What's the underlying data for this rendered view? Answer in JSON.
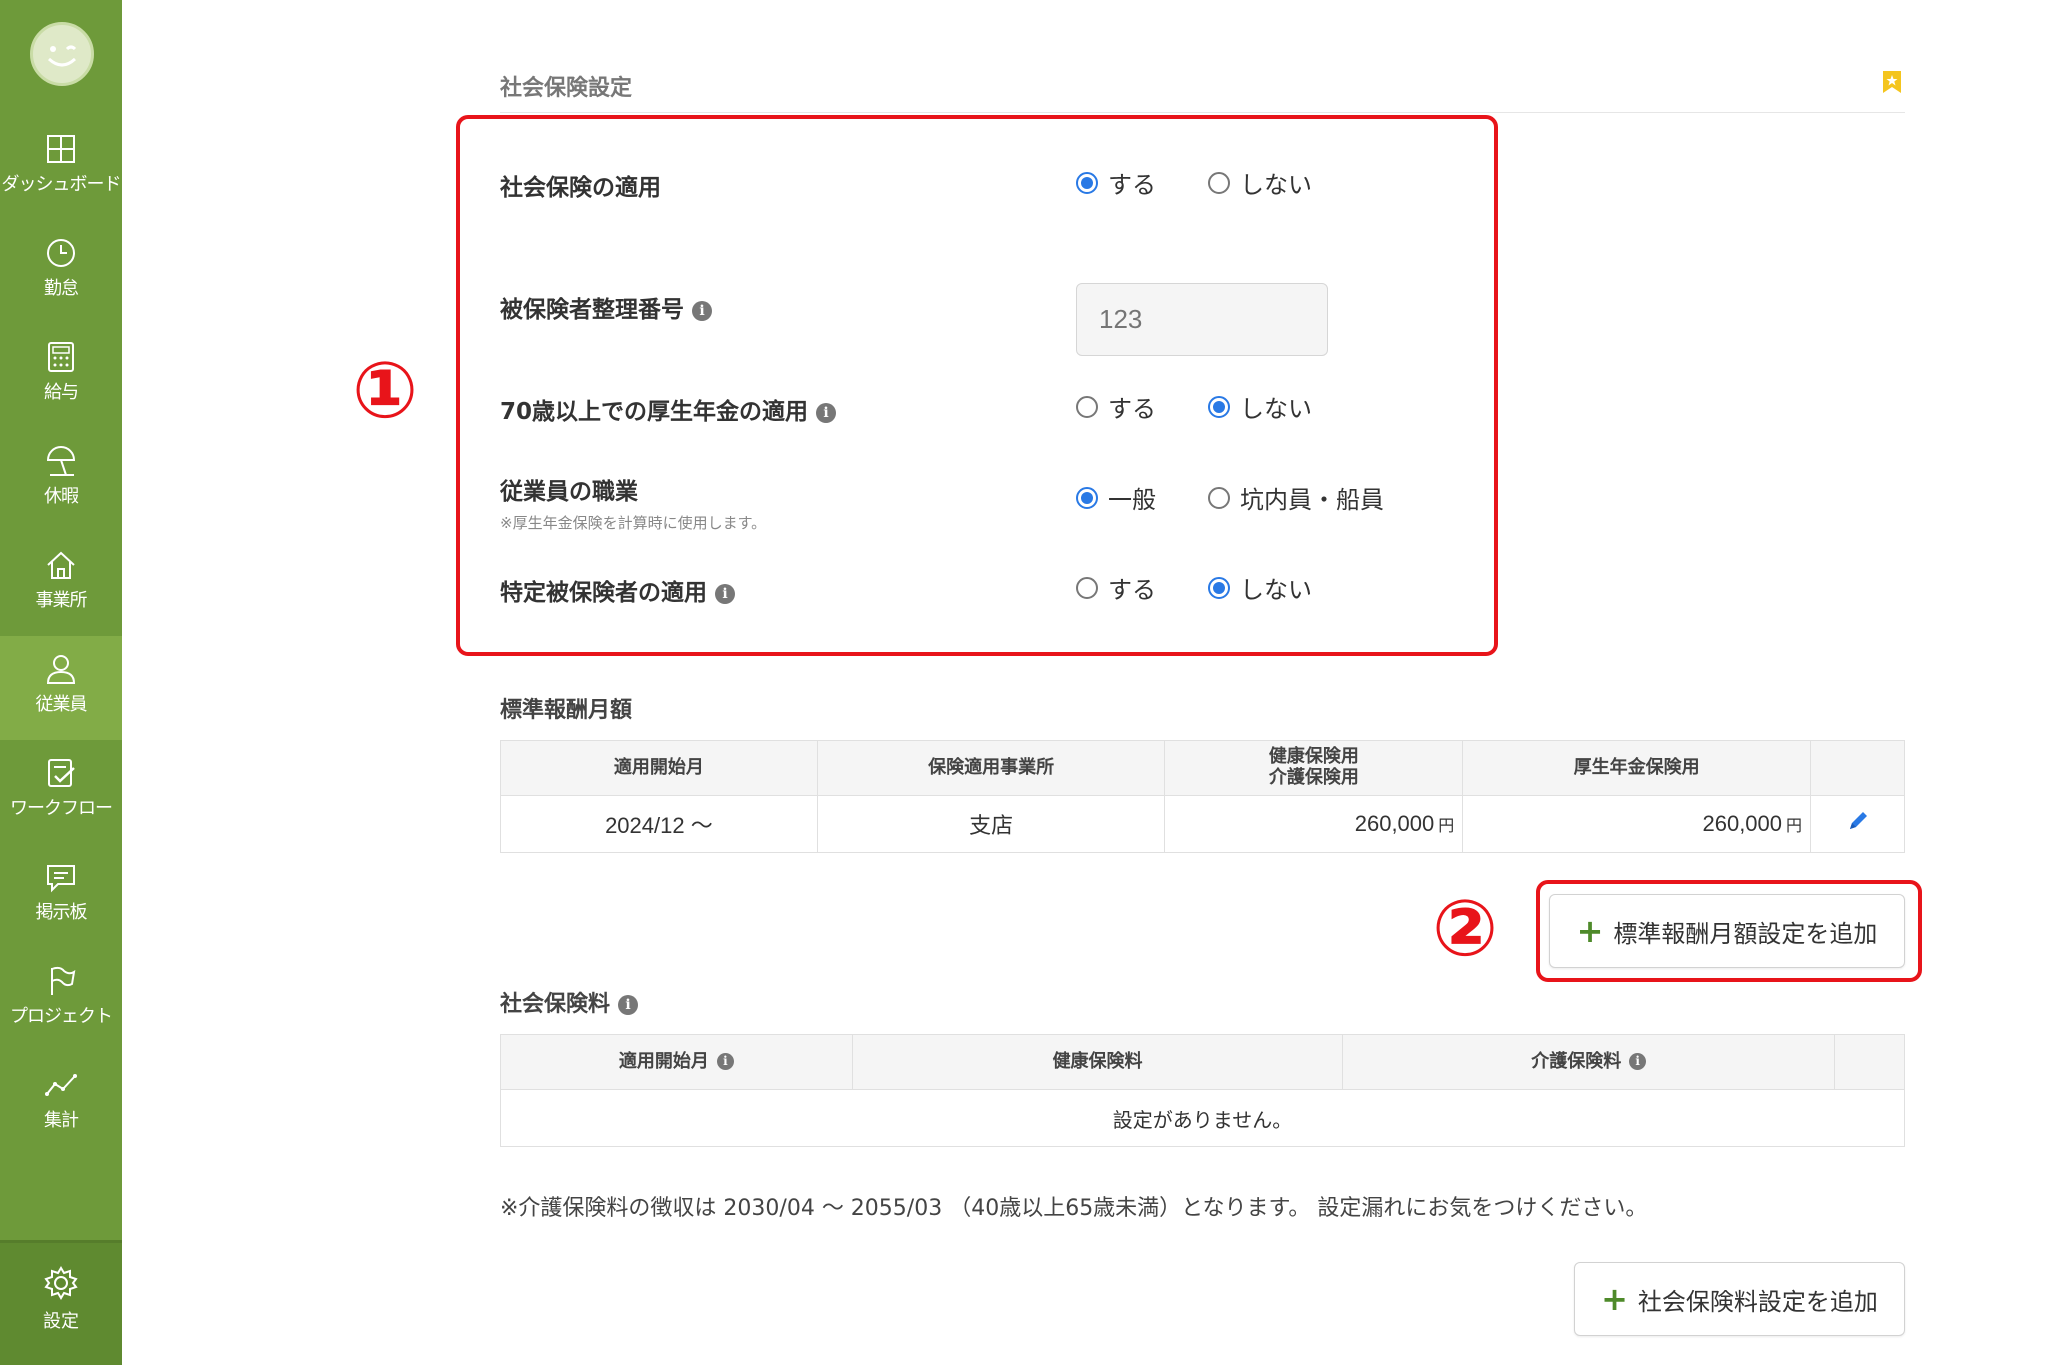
{
  "sidebar": {
    "items": [
      {
        "label": "ダッシュボード",
        "icon": "dashboard-icon"
      },
      {
        "label": "勤怠",
        "icon": "clock-icon"
      },
      {
        "label": "給与",
        "icon": "calculator-icon"
      },
      {
        "label": "休暇",
        "icon": "beach-umbrella-icon"
      },
      {
        "label": "事業所",
        "icon": "home-icon"
      },
      {
        "label": "従業員",
        "icon": "person-icon",
        "active": true
      },
      {
        "label": "ワークフロー",
        "icon": "checklist-icon"
      },
      {
        "label": "掲示板",
        "icon": "chat-icon"
      },
      {
        "label": "プロジェクト",
        "icon": "flag-icon"
      },
      {
        "label": "集計",
        "icon": "line-chart-icon"
      }
    ],
    "settings_label": "設定"
  },
  "section": {
    "title": "社会保険設定"
  },
  "annotations": {
    "one": "①",
    "two": "②"
  },
  "form": {
    "apply": {
      "label": "社会保険の適用",
      "opt_yes": "する",
      "opt_no": "しない",
      "selected": "yes"
    },
    "insured_number": {
      "label": "被保険者整理番号",
      "placeholder": "123"
    },
    "over70": {
      "label": "70歳以上での厚生年金の適用",
      "opt_yes": "する",
      "opt_no": "しない",
      "selected": "no"
    },
    "occupation": {
      "label": "従業員の職業",
      "note": "※厚生年金保険を計算時に使用します。",
      "opt_general": "一般",
      "opt_mine": "坑内員・船員",
      "selected": "general"
    },
    "specified": {
      "label": "特定被保険者の適用",
      "opt_yes": "する",
      "opt_no": "しない",
      "selected": "no"
    }
  },
  "standard_salary": {
    "title": "標準報酬月額",
    "headers": {
      "start": "適用開始月",
      "office": "保険適用事業所",
      "health_line1": "健康保険用",
      "health_line2": "介護保険用",
      "pension": "厚生年金保険用"
    },
    "rows": [
      {
        "start": "2024/12 〜",
        "office": "支店",
        "health": "260,000",
        "pension": "260,000",
        "unit": "円"
      }
    ],
    "add_button": "標準報酬月額設定を追加"
  },
  "premium": {
    "title": "社会保険料",
    "headers": {
      "start": "適用開始月",
      "health": "健康保険料",
      "care": "介護保険料"
    },
    "empty": "設定がありません。",
    "footnote": "※介護保険料の徴収は 2030/04 〜 2055/03 （40歳以上65歳未満）となります。 設定漏れにお気をつけください。",
    "add_button": "社会保険料設定を追加"
  },
  "colors": {
    "sidebar": "#6e9a3a",
    "accent_red": "#e8141a",
    "radio_blue": "#2979e5"
  }
}
